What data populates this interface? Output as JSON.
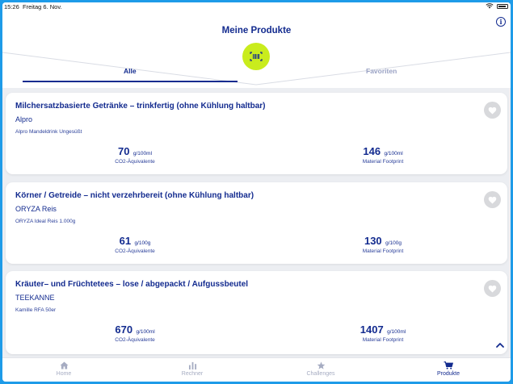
{
  "status_bar": {
    "time": "15:26",
    "date": "Freitag 6. Nov."
  },
  "header": {
    "title": "Meine Produkte",
    "info_icon": "info-icon",
    "info_label": "i"
  },
  "tabs": [
    {
      "label": "Alle",
      "active": true
    },
    {
      "label": "Favoriten",
      "active": false
    }
  ],
  "scan_button": {
    "icon": "barcode-scan-icon"
  },
  "products": [
    {
      "category": "Milchersatzbasierte Getränke – trinkfertig (ohne Kühlung haltbar)",
      "brand": "Alpro",
      "product": "Alpro Mandeldrink Ungesüßt",
      "co2_value": "70",
      "co2_unit": "g/100ml",
      "co2_label": "CO2-Äquivalente",
      "material_value": "146",
      "material_unit": "g/100ml",
      "material_label": "Material Footprint"
    },
    {
      "category": "Körner / Getreide – nicht verzehrbereit (ohne Kühlung haltbar)",
      "brand": "ORYZA Reis",
      "product": "ORYZA Ideal Reis 1.000g",
      "co2_value": "61",
      "co2_unit": "g/100g",
      "co2_label": "CO2-Äquivalente",
      "material_value": "130",
      "material_unit": "g/100g",
      "material_label": "Material Footprint"
    },
    {
      "category": "Kräuter– und Früchtetees – lose / abgepackt / Aufgussbeutel",
      "brand": "TEEKANNE",
      "product": "Kamille RFA 50er",
      "co2_value": "670",
      "co2_unit": "g/100ml",
      "co2_label": "CO2-Äquivalente",
      "material_value": "1407",
      "material_unit": "g/100ml",
      "material_label": "Material Footprint"
    }
  ],
  "nav": [
    {
      "label": "Home",
      "icon": "home-icon",
      "active": false
    },
    {
      "label": "Rechner",
      "icon": "bar-chart-icon",
      "active": false
    },
    {
      "label": "Challenges",
      "icon": "star-icon",
      "active": false
    },
    {
      "label": "Produkte",
      "icon": "cart-icon",
      "active": true
    }
  ],
  "colors": {
    "primary": "#132b8f",
    "accent": "#c9ec1d",
    "frame": "#1e9be8",
    "background": "#eceef2"
  }
}
